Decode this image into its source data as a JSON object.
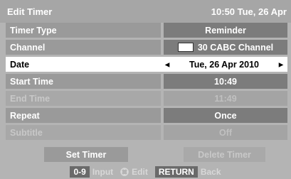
{
  "header": {
    "title": "Edit Timer",
    "clock": "10:50 Tue, 26 Apr"
  },
  "rows": [
    {
      "label": "Timer Type",
      "value": "Reminder"
    },
    {
      "label": "Channel",
      "value": "30 CABC Channel"
    },
    {
      "label": "Date",
      "value": "Tue, 26 Apr 2010"
    },
    {
      "label": "Start Time",
      "value": "10:49"
    },
    {
      "label": "End Time",
      "value": "11:49"
    },
    {
      "label": "Repeat",
      "value": "Once"
    },
    {
      "label": "Subtitle",
      "value": "Off"
    }
  ],
  "buttons": {
    "set_timer": "Set Timer",
    "delete_timer": "Delete Timer"
  },
  "footer": {
    "key_digits": "0-9",
    "input_label": "Input",
    "edit_label": "Edit",
    "key_return": "RETURN",
    "back_label": "Back"
  },
  "icons": {
    "left_arrow": "arrow-left",
    "right_arrow": "arrow-right",
    "dpad": "dpad"
  },
  "colors": {
    "selected_row": "#ffffff",
    "label_bg": "#9a9a9a",
    "value_bg": "#7c7c7c"
  }
}
